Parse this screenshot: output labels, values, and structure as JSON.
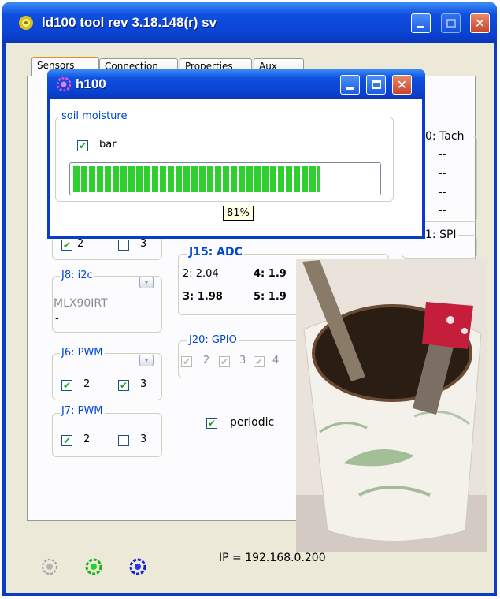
{
  "main": {
    "title": "ld100 tool rev 3.18.148(r)  sv",
    "tabs": [
      "Sensors",
      "Connection",
      "Properties",
      "Aux"
    ]
  },
  "h100": {
    "title": "h100",
    "group": "soil moisture",
    "bar_checkbox": "bar",
    "progress": 0.81,
    "progress_label": "81%"
  },
  "sensors": {
    "tach": "0: Tach",
    "tach_values": [
      "--",
      "--",
      "--",
      "--"
    ],
    "spi": "1: SPI",
    "top_row": [
      "2",
      "3"
    ],
    "j8": {
      "title": "J8: i2c",
      "device": "MLX90IRT",
      "value": "-"
    },
    "j6": {
      "title": "J6: PWM",
      "options": [
        "2",
        "3"
      ]
    },
    "j7": {
      "title": "J7: PWM",
      "options": [
        "2",
        "3"
      ]
    },
    "j15": {
      "title": "J15: ADC",
      "cells": [
        "2: 2.04",
        "4: 1.9",
        "3: 1.98",
        "5: 1.9"
      ]
    },
    "j20": {
      "title": "J20: GPIO",
      "pins": [
        "2",
        "3",
        "4"
      ]
    },
    "periodic": "periodic",
    "ip": "IP = 192.168.0.200"
  },
  "colors": {
    "titlebar": "#0a43d2",
    "legend": "#0046d5",
    "progress": "#2fcf2f",
    "close": "#c8452a"
  }
}
